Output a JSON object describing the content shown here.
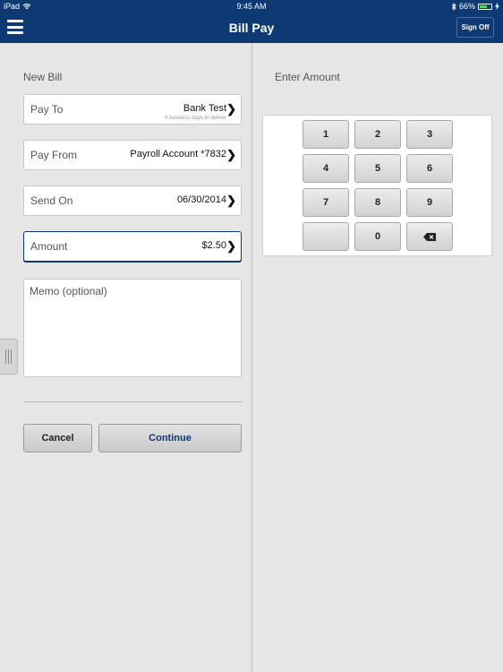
{
  "status_bar": {
    "device": "iPad",
    "time": "9:45 AM",
    "battery": "66%",
    "battery_level": 0.66
  },
  "nav": {
    "title": "Bill Pay",
    "sign_off": "Sign Off"
  },
  "left": {
    "section_title": "New Bill",
    "fields": {
      "pay_to": {
        "label": "Pay To",
        "value": "Bank Test",
        "note": "4 business days to deliver"
      },
      "pay_from": {
        "label": "Pay From",
        "value": "Payroll Account *7832"
      },
      "send_on": {
        "label": "Send On",
        "value": "06/30/2014"
      },
      "amount": {
        "label": "Amount",
        "value": "$2.50"
      }
    },
    "memo_placeholder": "Memo (optional)",
    "buttons": {
      "cancel": "Cancel",
      "continue": "Continue"
    }
  },
  "right": {
    "section_title": "Enter Amount",
    "keys": [
      "1",
      "2",
      "3",
      "4",
      "5",
      "6",
      "7",
      "8",
      "9",
      "",
      "0"
    ]
  },
  "colors": {
    "nav_bg": "#0e3a73",
    "pane_bg": "#e6e6e6",
    "accent": "#0e3a73"
  },
  "icons": {
    "menu": "hamburger-icon",
    "chevron": "chevron-right-icon",
    "backspace": "backspace-icon",
    "wifi": "wifi-icon",
    "bluetooth": "bluetooth-icon",
    "battery": "battery-icon"
  }
}
